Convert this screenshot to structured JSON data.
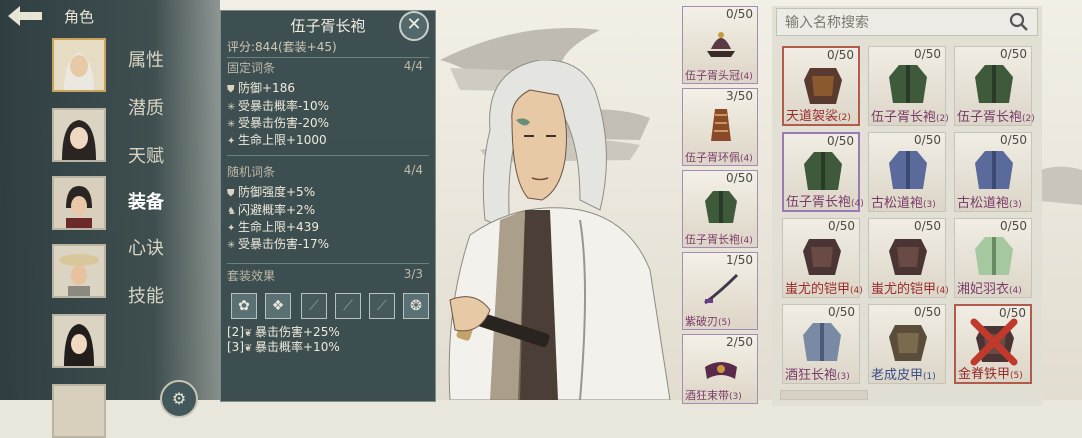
{
  "nav": {
    "back_icon": "back-arrow-icon",
    "title": "角色",
    "tabs": [
      "属性",
      "潜质",
      "天赋",
      "装备",
      "心诀",
      "技能"
    ],
    "active_tab": "装备",
    "round_button_icon": "gear-icon"
  },
  "tooltip": {
    "title": "伍子胥长袍",
    "score_label": "评分:",
    "score_value": "844(套装+45)",
    "fixed_header": "固定词条",
    "fixed_count": "4/4",
    "fixed_stats": [
      "防御+186",
      "受暴击概率-10%",
      "受暴击伤害-20%",
      "生命上限+1000"
    ],
    "random_header": "随机词条",
    "random_count": "4/4",
    "random_stats": [
      "防御强度+5%",
      "闪避概率+2%",
      "生命上限+439",
      "受暴击伤害-17%"
    ],
    "set_header": "套装效果",
    "set_count": "3/3",
    "set_bonuses": [
      "[2]",
      "暴击伤害+25%",
      "[3]",
      "暴击概率+10%"
    ],
    "colors": {
      "panel": "#35484a",
      "text": "#efeadc"
    }
  },
  "equipped": [
    {
      "name": "伍子胥头冠",
      "level": "(4)",
      "count": "0/50",
      "icon": "hat-icon"
    },
    {
      "name": "伍子胥环佩",
      "level": "(4)",
      "count": "3/50",
      "icon": "pendant-icon"
    },
    {
      "name": "伍子胥长袍",
      "level": "(4)",
      "count": "0/50",
      "icon": "robe-icon"
    },
    {
      "name": "紫破刃",
      "level": "(5)",
      "count": "1/50",
      "icon": "blade-icon"
    },
    {
      "name": "酒狂束带",
      "level": "(3)",
      "count": "2/50",
      "icon": "belt-icon"
    }
  ],
  "inventory": {
    "search_placeholder": "输入名称搜索",
    "items": [
      {
        "name": "天道袈裟",
        "level": "(2)",
        "count": "0/50",
        "color": "red"
      },
      {
        "name": "伍子胥长袍",
        "level": "(2)",
        "count": "0/50",
        "color": "purple"
      },
      {
        "name": "伍子胥长袍",
        "level": "(2)",
        "count": "0/50",
        "color": "purple"
      },
      {
        "name": "伍子胥长袍",
        "level": "(4)",
        "count": "0/50",
        "color": "purple"
      },
      {
        "name": "古松道袍",
        "level": "(3)",
        "count": "0/50",
        "color": "purple"
      },
      {
        "name": "古松道袍",
        "level": "(3)",
        "count": "0/50",
        "color": "purple"
      },
      {
        "name": "蚩尤的铠甲",
        "level": "(4)",
        "count": "0/50",
        "color": "red"
      },
      {
        "name": "蚩尤的铠甲",
        "level": "(4)",
        "count": "0/50",
        "color": "red"
      },
      {
        "name": "湘妃羽衣",
        "level": "(4)",
        "count": "0/50",
        "color": "purple"
      },
      {
        "name": "酒狂长袍",
        "level": "(3)",
        "count": "0/50",
        "color": "blue"
      },
      {
        "name": "老成皮甲",
        "level": "(1)",
        "count": "0/50",
        "color": "blue"
      },
      {
        "name": "金脊铁甲",
        "level": "(5)",
        "count": "0/50",
        "color": "red"
      }
    ]
  }
}
